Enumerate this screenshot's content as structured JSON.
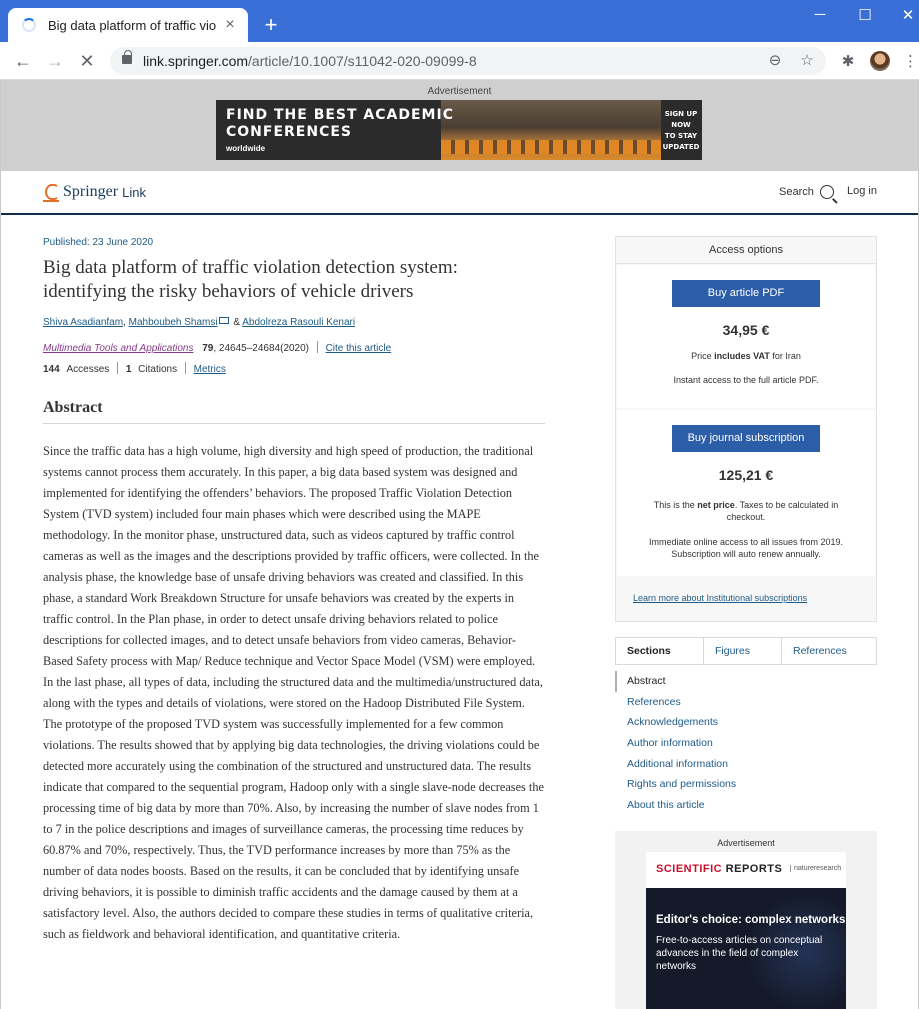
{
  "browser": {
    "tab_title": "Big data platform of traffic violation detection system",
    "tab_close": "×",
    "new_tab": "+",
    "window_controls": {
      "minimize": "─",
      "maximize": "☐",
      "close": "✕"
    },
    "back": "←",
    "forward": "→",
    "reload_stop": "✕",
    "url_domain": "link.springer.com",
    "url_path": "/article/10.1007/s11042-020-09099-8",
    "zoom_icon": "⊖",
    "star_icon": "☆",
    "extensions_icon": "✱",
    "menu_icon": "⋮"
  },
  "ad_top": {
    "label": "Advertisement",
    "headline_1": "FIND THE BEST ACADEMIC",
    "headline_2": "CONFERENCES",
    "sub": "worldwide",
    "cta_1": "SIGN UP",
    "cta_2": "NOW",
    "cta_3": "TO STAY",
    "cta_4": "UPDATED"
  },
  "header": {
    "logo_name": "Springer",
    "logo_link": "Link",
    "search": "Search",
    "login": "Log in"
  },
  "article": {
    "published": "Published: 23 June 2020",
    "title": "Big data platform of traffic violation detection system: identifying the risky behaviors of vehicle drivers",
    "authors": [
      "Shiva Asadianfam",
      "Mahboubeh Shamsi",
      "Abdolreza Rasouli Kenari"
    ],
    "author_sep_1": ", ",
    "author_amp": " & ",
    "journal": "Multimedia Tools and Applications",
    "volume": "79",
    "pages": ", 24645–24684(2020)",
    "cite": "Cite this article",
    "accesses_count": "144",
    "accesses_label": "Accesses",
    "citations_count": "1",
    "citations_label": "Citations",
    "metrics": "Metrics",
    "abstract_heading": "Abstract",
    "abstract": "Since the traffic data has a high volume, high diversity and high speed of production, the traditional systems cannot process them accurately. In this paper, a big data based system was designed and implemented for identifying the offenders’ behaviors. The proposed Traffic Violation Detection System (TVD system) included four main phases which were described using the MAPE methodology. In the monitor phase, unstructured data, such as videos captured by traffic control cameras as well as the images and the descriptions provided by traffic officers, were collected. In the analysis phase, the knowledge base of unsafe driving behaviors was created and classified. In this phase, a standard Work Breakdown Structure for unsafe behaviors was created by the experts in traffic control. In the Plan phase, in order to detect unsafe driving behaviors related to police descriptions for collected images, and to detect unsafe behaviors from video cameras, Behavior-Based Safety process with Map/ Reduce technique and Vector Space Model (VSM) were employed. In the last phase, all types of data, including the structured data and the multimedia/unstructured data, along with the types and details of violations, were stored on the Hadoop Distributed File System. The prototype of the proposed TVD system was successfully implemented for a few common violations. The results showed that by applying big data technologies, the driving violations could be detected more accurately using the combination of the structured and unstructured data. The results indicate that compared to the sequential program, Hadoop only with a single slave-node decreases the processing time of big data by more than 70%. Also, by increasing the number of slave nodes from 1 to 7 in the police descriptions and images of surveillance cameras, the processing time reduces by 60.87% and 70%, respectively. Thus, the TVD performance increases by more than 75% as the number of data nodes boosts. Based on the results, it can be concluded that by identifying unsafe driving behaviors, it is possible to diminish traffic accidents and the damage caused by them at a satisfactory level. Also, the authors decided to compare these studies in terms of qualitative criteria, such as fieldwork and behavioral identification, and quantitative criteria."
  },
  "access": {
    "heading": "Access options",
    "buy_pdf": "Buy article PDF",
    "pdf_price": "34,95 €",
    "vat_pre": "Price ",
    "vat_bold": "includes VAT",
    "vat_post": " for Iran",
    "pdf_note": "Instant access to the full article PDF.",
    "buy_sub": "Buy journal subscription",
    "sub_price": "125,21 €",
    "net_pre": "This is the ",
    "net_bold": "net price",
    "net_post": ". Taxes to be calculated in checkout.",
    "sub_note": "Immediate online access to all issues from 2019. Subscription will auto renew annually.",
    "learn_more": "Learn more about Institutional subscriptions"
  },
  "nav_tabs": [
    "Sections",
    "Figures",
    "References"
  ],
  "sections": [
    "Abstract",
    "References",
    "Acknowledgements",
    "Author information",
    "Additional information",
    "Rights and permissions",
    "About this article"
  ],
  "ad_side": {
    "label": "Advertisement",
    "brand_red": "SCIENTIFIC",
    "brand_dark": " REPORTS",
    "brand_sub": "natureresearch",
    "headline": "Editor's choice: complex networks",
    "sub": "Free-to-access articles on conceptual advances in the field of complex networks"
  },
  "colors": {
    "chrome_blue": "#3a6fd8",
    "springer_blue": "#2c5ea8",
    "link_blue": "#1f5b87",
    "journal_purple": "#8a3a8c",
    "springer_orange": "#e0702a"
  }
}
